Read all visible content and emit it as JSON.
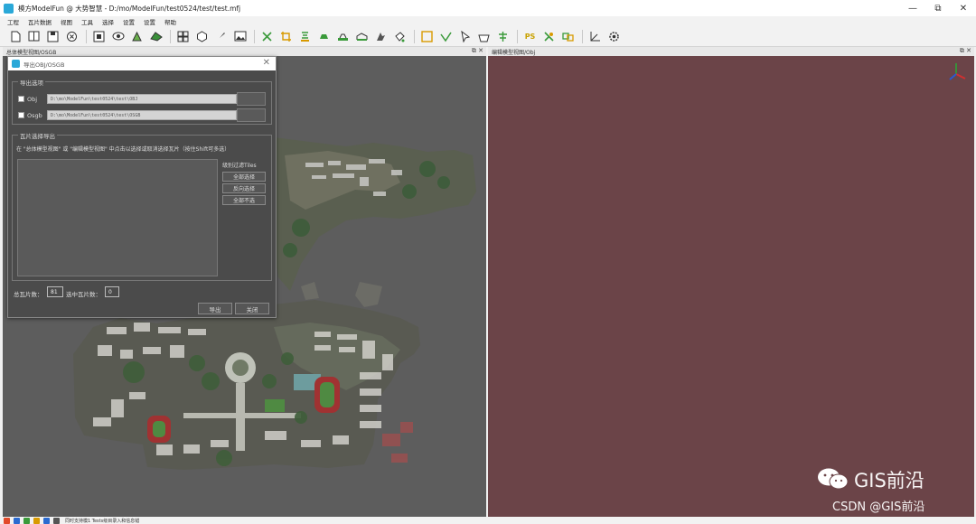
{
  "window": {
    "title": "模方ModelFun @ 大势智慧 - D:/mo/ModelFun/test0524/test/test.mfj",
    "controls": {
      "minimize": "—",
      "restore": "⧉",
      "close": "✕"
    }
  },
  "menu": [
    "工程",
    "瓦片数据",
    "视图",
    "工具",
    "选择",
    "设置",
    "设置",
    "帮助"
  ],
  "toolbar_icons": [
    "new-file-icon",
    "open-icon",
    "save-icon",
    "close-circle-icon",
    "select-box-icon",
    "eye-icon",
    "model-icon",
    "mesh-icon",
    "grid-icon",
    "cube-icon",
    "brush-icon",
    "image-icon",
    "cut-icon",
    "crop-icon",
    "texture-icon",
    "fill-icon",
    "flatten-icon",
    "bridge-icon",
    "repair-icon",
    "paint-bucket-icon",
    "frame-icon",
    "check-icon",
    "pointer-icon",
    "basket-icon",
    "align-icon",
    "ps-icon",
    "green-tool-icon",
    "link-icon",
    "axis-icon",
    "settings-icon"
  ],
  "panels": {
    "left_title": "总体模型视图/OSGB",
    "right_title": "编辑模型视图/Obj",
    "panel_controls": "⧉ ✕"
  },
  "dialog": {
    "title": "导出OBJ/OSGB",
    "close": "✕",
    "export_group": "导出选项",
    "obj": {
      "label": "Obj",
      "path": "D:\\mo\\ModelFun\\test0524\\test\\OBJ"
    },
    "osgb": {
      "label": "Osgb",
      "path": "D:\\mo\\ModelFun\\test0524\\test\\OSGB"
    },
    "tile_group": "瓦片选择导出",
    "hint": "在 \"总体模型视图\" 或 \"编辑模型视图\" 中点击以选择或取消选择瓦片（按住Shift可多选）",
    "side_label": "级别过滤Tiles",
    "select_all": "全部选择",
    "invert": "反向选择",
    "select_none": "全部不选",
    "total_label": "总瓦片数：",
    "total_value": "81",
    "selected_label": "选中瓦片数：",
    "selected_value": "0",
    "export_btn": "导出",
    "close_btn": "关闭"
  },
  "watermark": {
    "brand": "GIS前沿",
    "sub": "CSDN @GIS前沿"
  },
  "taskbar": {
    "text": "同时支持模1 Tests级目录入和信息错"
  },
  "colors": {
    "left_view_bg": "#5d5d5d",
    "right_view_bg": "#6b4448",
    "dialog_bg": "#4b4b4b",
    "accent": "#2aa8d8"
  }
}
